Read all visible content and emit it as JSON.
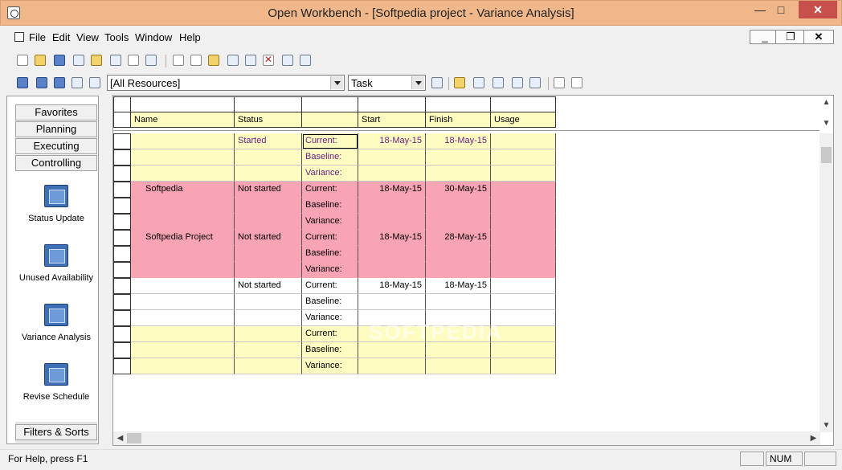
{
  "window": {
    "title": "Open Workbench - [Softpedia project - Variance Analysis]"
  },
  "menu": [
    "File",
    "Edit",
    "View",
    "Tools",
    "Window",
    "Help"
  ],
  "toolbar": {
    "resource_filter": "[All Resources]",
    "view_type": "Task"
  },
  "leftpanel": {
    "tabs": [
      "Favorites",
      "Planning",
      "Executing",
      "Controlling"
    ],
    "views": [
      {
        "label": "Status Update",
        "icon": "clock-icon"
      },
      {
        "label": "Unused Availability",
        "icon": "person-icon"
      },
      {
        "label": "Variance Analysis",
        "icon": "chart-icon"
      },
      {
        "label": "Revise Schedule",
        "icon": "schedule-icon"
      }
    ],
    "bottom_button": "Filters & Sorts"
  },
  "grid": {
    "headers": [
      "Name",
      "Status",
      "",
      "Start",
      "Finish",
      "Usage"
    ],
    "rows": [
      {
        "name": "",
        "status": "Started",
        "type": "Current:",
        "start": "18-May-15",
        "finish": "18-May-15",
        "usage": "",
        "band": "yellow",
        "purple": true
      },
      {
        "name": "",
        "status": "",
        "type": "Baseline:",
        "start": "",
        "finish": "",
        "usage": "",
        "band": "yellow",
        "purple": true
      },
      {
        "name": "",
        "status": "",
        "type": "Variance:",
        "start": "",
        "finish": "",
        "usage": "",
        "band": "yellow",
        "purple": true
      },
      {
        "name": "Softpedia",
        "status": "Not started",
        "type": "Current:",
        "start": "18-May-15",
        "finish": "30-May-15",
        "usage": "",
        "band": "pink",
        "purple": false
      },
      {
        "name": "",
        "status": "",
        "type": "Baseline:",
        "start": "",
        "finish": "",
        "usage": "",
        "band": "pink",
        "purple": false
      },
      {
        "name": "",
        "status": "",
        "type": "Variance:",
        "start": "",
        "finish": "",
        "usage": "",
        "band": "pink",
        "purple": false
      },
      {
        "name": "Softpedia Project",
        "status": "Not started",
        "type": "Current:",
        "start": "18-May-15",
        "finish": "28-May-15",
        "usage": "",
        "band": "pink",
        "purple": false
      },
      {
        "name": "",
        "status": "",
        "type": "Baseline:",
        "start": "",
        "finish": "",
        "usage": "",
        "band": "pink",
        "purple": false
      },
      {
        "name": "",
        "status": "",
        "type": "Variance:",
        "start": "",
        "finish": "",
        "usage": "",
        "band": "pink",
        "purple": false
      },
      {
        "name": "",
        "status": "Not started",
        "type": "Current:",
        "start": "18-May-15",
        "finish": "18-May-15",
        "usage": "",
        "band": "white",
        "purple": false
      },
      {
        "name": "",
        "status": "",
        "type": "Baseline:",
        "start": "",
        "finish": "",
        "usage": "",
        "band": "white",
        "purple": false
      },
      {
        "name": "",
        "status": "",
        "type": "Variance:",
        "start": "",
        "finish": "",
        "usage": "",
        "band": "white",
        "purple": false
      },
      {
        "name": "",
        "status": "",
        "type": "Current:",
        "start": "",
        "finish": "",
        "usage": "",
        "band": "yellow",
        "purple": false
      },
      {
        "name": "",
        "status": "",
        "type": "Baseline:",
        "start": "",
        "finish": "",
        "usage": "",
        "band": "yellow",
        "purple": false
      },
      {
        "name": "",
        "status": "",
        "type": "Variance:",
        "start": "",
        "finish": "",
        "usage": "",
        "band": "yellow",
        "purple": false
      }
    ]
  },
  "watermark": "SOFTPEDIA",
  "statusbar": {
    "message": "For Help, press F1",
    "num": "NUM"
  }
}
